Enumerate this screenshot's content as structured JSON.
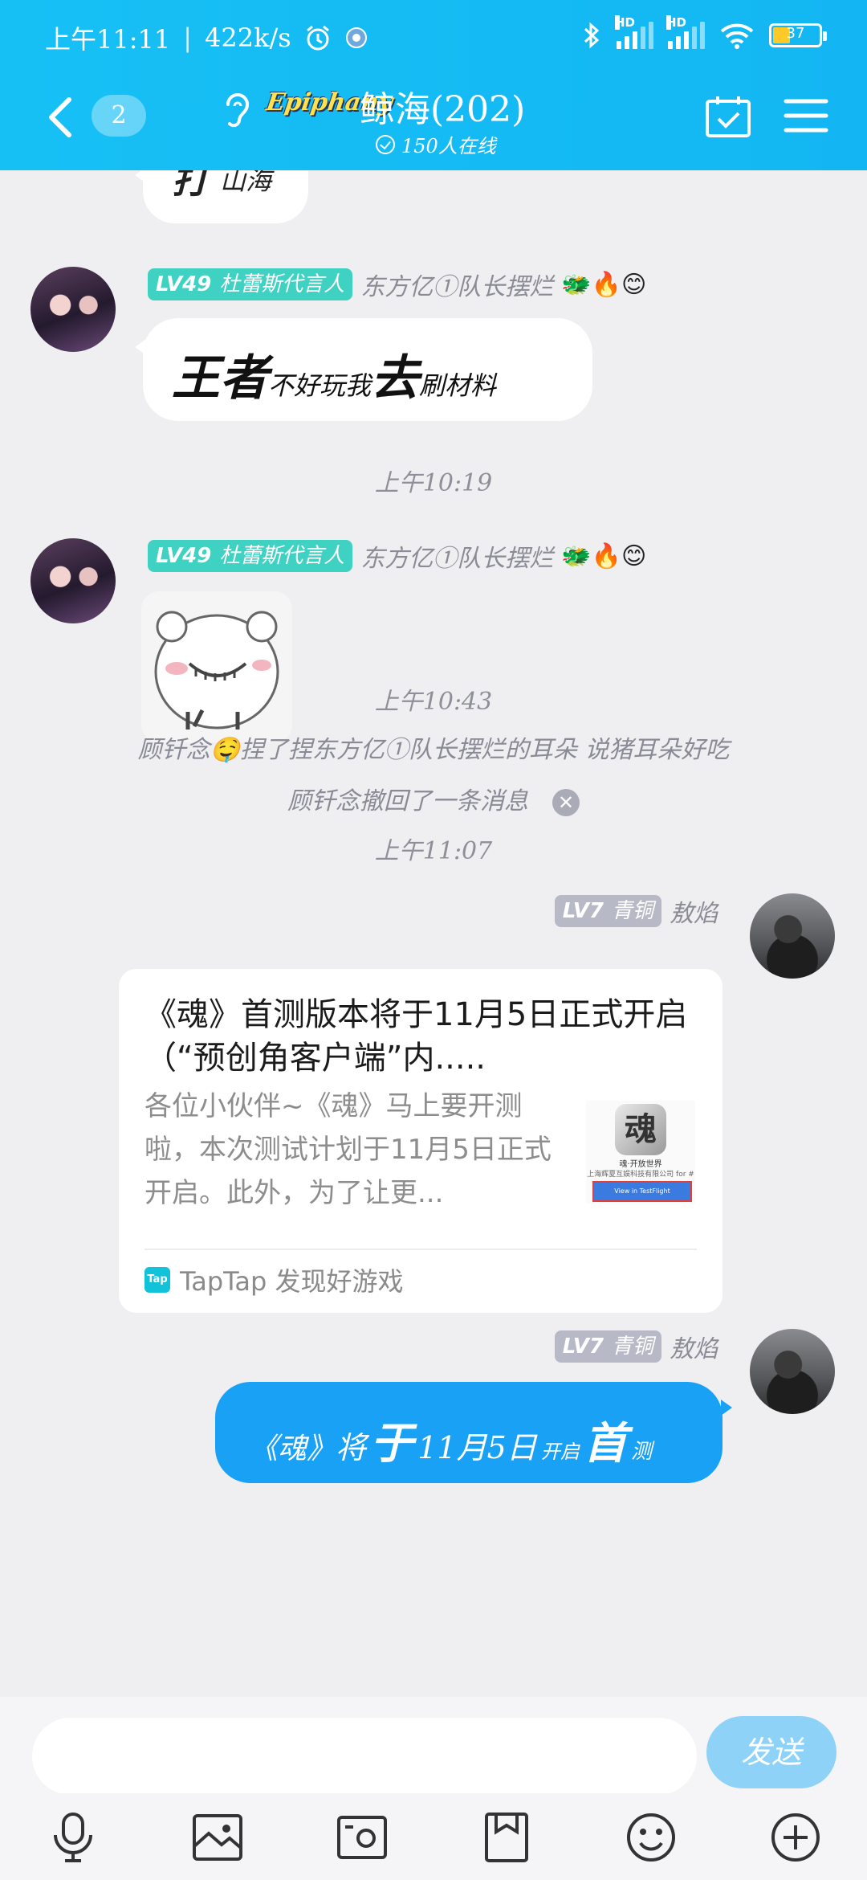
{
  "status_bar": {
    "time": "上午11:11",
    "speed": "422k/s",
    "hd1": "HD",
    "hd2": "HD",
    "battery": "37",
    "battery_level": 0.37
  },
  "header": {
    "unread": "2",
    "logo_text": "Epiphany",
    "group_name": "鲸海(202)",
    "online_text": "150人在线"
  },
  "messages": {
    "partial": {
      "text_big": "打",
      "text_small": "山海"
    },
    "m1": {
      "level": "LV49",
      "title": "杜蕾斯代言人",
      "sender": "东方亿①队长摆烂",
      "emojis": "🐲🔥😊",
      "text_parts": [
        "王",
        "者",
        "不好玩我",
        "去",
        "刷材料"
      ]
    },
    "t1": "上午10:19",
    "m2": {
      "level": "LV49",
      "title": "杜蕾斯代言人",
      "sender": "东方亿①队长摆烂",
      "emojis": "🐲🔥😊"
    },
    "t2": "上午10:43",
    "sys1": "顾钎念🤤捏了捏东方亿①队长摆烂的耳朵 说猪耳朵好吃",
    "sys2": "顾钎念撤回了一条消息",
    "t3": "上午11:07",
    "m3": {
      "level": "LV7",
      "title": "青铜",
      "sender": "敖焰",
      "card_title": "《魂》首测版本将于11月5日正式开启（“预创角客户端”内.....",
      "card_desc": "各位小伙伴~《魂》马上要开测啦，本次测试计划于11月5日正式开启。此外，为了让更...",
      "thumb_caption": "魂·开放世界",
      "thumb_company": "上海辉夏互娱科技有限公司 for #",
      "thumb_button": "View in TestFlight",
      "source_icon": "Tap",
      "source": "TapTap 发现好游戏"
    },
    "m4": {
      "level": "LV7",
      "title": "青铜",
      "sender": "敖焰",
      "text_parts": [
        "《魂》",
        "将",
        "于",
        "11月5日",
        "开启",
        "首",
        "测"
      ]
    }
  },
  "input": {
    "placeholder": "",
    "send_label": "发送"
  },
  "icons": [
    "back-icon",
    "ear-icon",
    "calendar-check-icon",
    "menu-icon",
    "microphone-icon",
    "image-icon",
    "camera-icon",
    "file-icon",
    "emoji-icon",
    "plus-icon"
  ],
  "colors": {
    "header": "#16c0f5",
    "teal_badge": "#3fd1c2",
    "gray_badge": "#b7b9c6",
    "my_bubble": "#18a1f5",
    "send_button": "#8fd2f8"
  }
}
